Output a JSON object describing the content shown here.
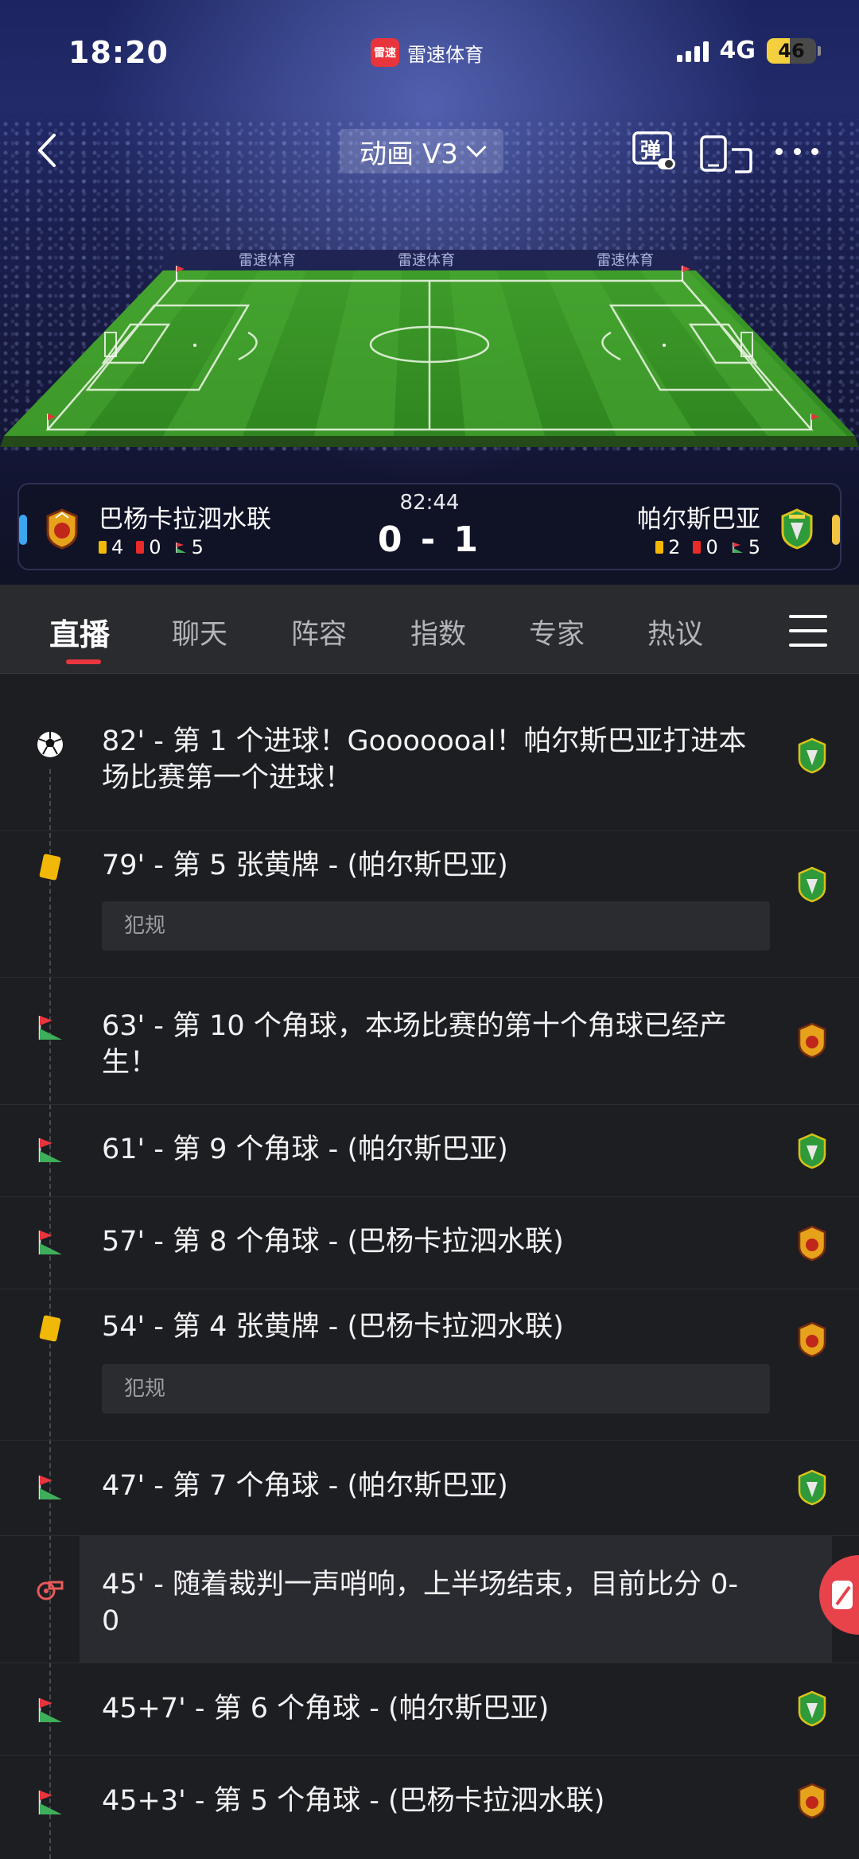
{
  "status_bar": {
    "time": "18:20",
    "app_name": "雷速体育",
    "app_logo_text": "雷速",
    "network": "4G",
    "battery": "46",
    "battery_level": 0.46
  },
  "header": {
    "mode_label": "动画 V3",
    "danmu_label": "弹",
    "icons": [
      "back-icon",
      "chevron-down-icon",
      "danmu-icon",
      "device-switch-icon",
      "more-icon"
    ]
  },
  "pitch": {
    "ad_board": "雷速体育"
  },
  "match": {
    "clock": "82:44",
    "score": "0 - 1",
    "home": {
      "name": "巴杨卡拉泗水联",
      "yellow": "4",
      "red": "0",
      "corners": "5"
    },
    "away": {
      "name": "帕尔斯巴亚",
      "yellow": "2",
      "red": "0",
      "corners": "5"
    },
    "colors": {
      "home_indicator": "#3aa7f0",
      "away_indicator": "#f2c542"
    }
  },
  "tabs": [
    {
      "label": "直播",
      "active": true
    },
    {
      "label": "聊天"
    },
    {
      "label": "阵容"
    },
    {
      "label": "指数"
    },
    {
      "label": "专家"
    },
    {
      "label": "热议"
    }
  ],
  "events": [
    {
      "icon": "goal",
      "text": "82' - 第 1 个进球！Gooooooal！帕尔斯巴亚打进本场比赛第一个进球！",
      "team": "away"
    },
    {
      "icon": "yellow-card",
      "text": "79' - 第 5 张黄牌 - (帕尔斯巴亚)",
      "note": "犯规",
      "team": "away"
    },
    {
      "icon": "corner",
      "text": "63' - 第 10 个角球，本场比赛的第十个角球已经产生！",
      "team": "home"
    },
    {
      "icon": "corner",
      "text": "61' - 第 9 个角球 - (帕尔斯巴亚)",
      "team": "away"
    },
    {
      "icon": "corner",
      "text": "57' - 第 8 个角球 - (巴杨卡拉泗水联)",
      "team": "home"
    },
    {
      "icon": "yellow-card",
      "text": "54' - 第 4 张黄牌 - (巴杨卡拉泗水联)",
      "note": "犯规",
      "team": "home"
    },
    {
      "icon": "corner",
      "text": "47' - 第 7 个角球 - (帕尔斯巴亚)",
      "team": "away"
    },
    {
      "icon": "whistle",
      "text": "45' - 随着裁判一声哨响，上半场结束，目前比分 0-0",
      "team": "none"
    },
    {
      "icon": "corner",
      "text": "45+7' - 第 6 个角球 - (帕尔斯巴亚)",
      "team": "away"
    },
    {
      "icon": "corner",
      "text": "45+3' - 第 5 个角球 - (巴杨卡拉泗水联)",
      "team": "home"
    }
  ]
}
